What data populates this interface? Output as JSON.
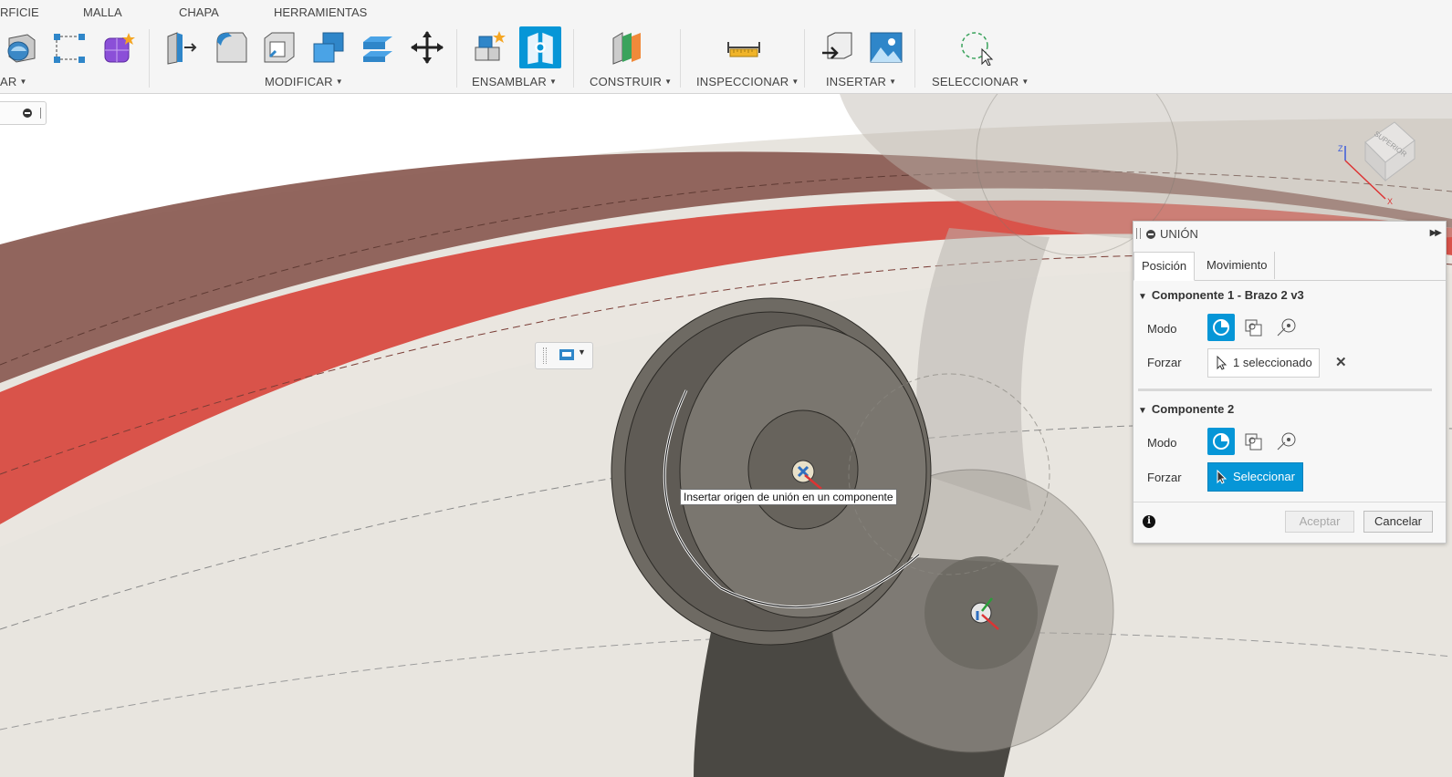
{
  "menu_tabs": [
    "RFICIE",
    "MALLA",
    "CHAPA",
    "HERRAMIENTAS"
  ],
  "toolbar_groups": {
    "create_partial": "AR",
    "modify": "MODIFICAR",
    "assemble": "ENSAMBLAR",
    "construct": "CONSTRUIR",
    "inspect": "INSPECCIONAR",
    "insert": "INSERTAR",
    "select": "SELECCIONAR"
  },
  "icons": [
    "revolve-icon",
    "pattern-icon",
    "form-icon",
    "press-pull-icon",
    "fillet-icon",
    "shell-icon",
    "combine-icon",
    "offset-face-icon",
    "move-icon",
    "new-component-icon",
    "joint-icon",
    "offset-plane-icon",
    "measure-icon",
    "insert-derive-icon",
    "canvas-image-icon",
    "select-window-icon"
  ],
  "viewcube_face": "SUPERIOR",
  "tooltip": "Insertar origen de unión en un componente",
  "panel": {
    "title": "UNIÓN",
    "tabs": [
      "Posición",
      "Movimiento"
    ],
    "active_tab": "Posición",
    "component1": {
      "title": "Componente 1 - Brazo 2 v3",
      "mode_label": "Modo",
      "snap_label": "Forzar",
      "selection": "1 seleccionado"
    },
    "component2": {
      "title": "Componente 2",
      "mode_label": "Modo",
      "snap_label": "Forzar",
      "selection": "Seleccionar"
    },
    "ok_label": "Aceptar",
    "cancel_label": "Cancelar",
    "accent_color": "#0696d7"
  }
}
